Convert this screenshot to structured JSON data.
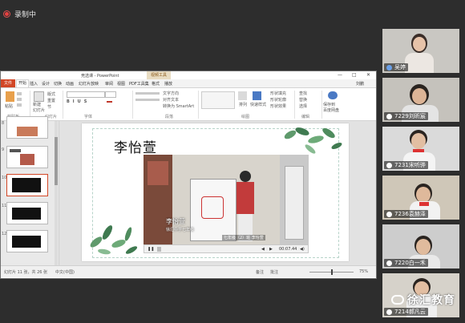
{
  "recording": {
    "status": "录制中"
  },
  "ppt": {
    "window_title": "竞选课 - PowerPoint",
    "context_tab": "视频工具",
    "tabs": [
      "文件",
      "开始",
      "插入",
      "设计",
      "切换",
      "动画",
      "幻灯片放映",
      "审阅",
      "视图",
      "PDF工具集",
      "格式",
      "播放"
    ],
    "user_name": "刘鹏",
    "ribbon_groups": [
      "剪贴板",
      "幻灯片",
      "字体",
      "段落",
      "绘图",
      "编辑"
    ],
    "ribbon_labels": {
      "paste": "粘贴",
      "new_slide": "新建\n幻灯片",
      "layout": "版式",
      "reset": "重置",
      "section": "节",
      "text_direction": "文字方向",
      "align_text": "对齐文本",
      "smartart": "转换为 SmartArt",
      "arrange": "排列",
      "quick_styles": "快速样式",
      "shape_fill": "形状填充",
      "shape_outline": "形状轮廓",
      "shape_effects": "形状效果",
      "find": "查找",
      "replace": "替换",
      "select": "选择",
      "share": "保存到\n百度网盘"
    },
    "slide": {
      "title": "李怡萱",
      "video_caption_name": "李怡萱",
      "video_caption_school": "徐汇中学七年级",
      "video_caption_class": "七年级（2）班 李怡萱",
      "video_time": "00:07.44"
    },
    "status": {
      "slide_info": "幻灯片 11 张，共 26 张",
      "language": "中文(中国)",
      "notes": "备注",
      "comments": "批注",
      "zoom": "75%"
    }
  },
  "participants": [
    {
      "name": "吴婷",
      "hue": "#c9c7c2"
    },
    {
      "name": "7229刘昕宸",
      "hue": "#c5c2bc"
    },
    {
      "name": "7231宋听骅",
      "hue": "#dadada"
    },
    {
      "name": "7236袁赫泽",
      "hue": "#cfc7b8"
    },
    {
      "name": "7220白一禾",
      "hue": "#cdcdcd"
    },
    {
      "name": "7214郝凡云",
      "hue": "#d6d2ca"
    }
  ],
  "watermark": {
    "text": "徐汇教育"
  },
  "colors": {
    "accent": "#d24726",
    "record": "#e84040"
  }
}
